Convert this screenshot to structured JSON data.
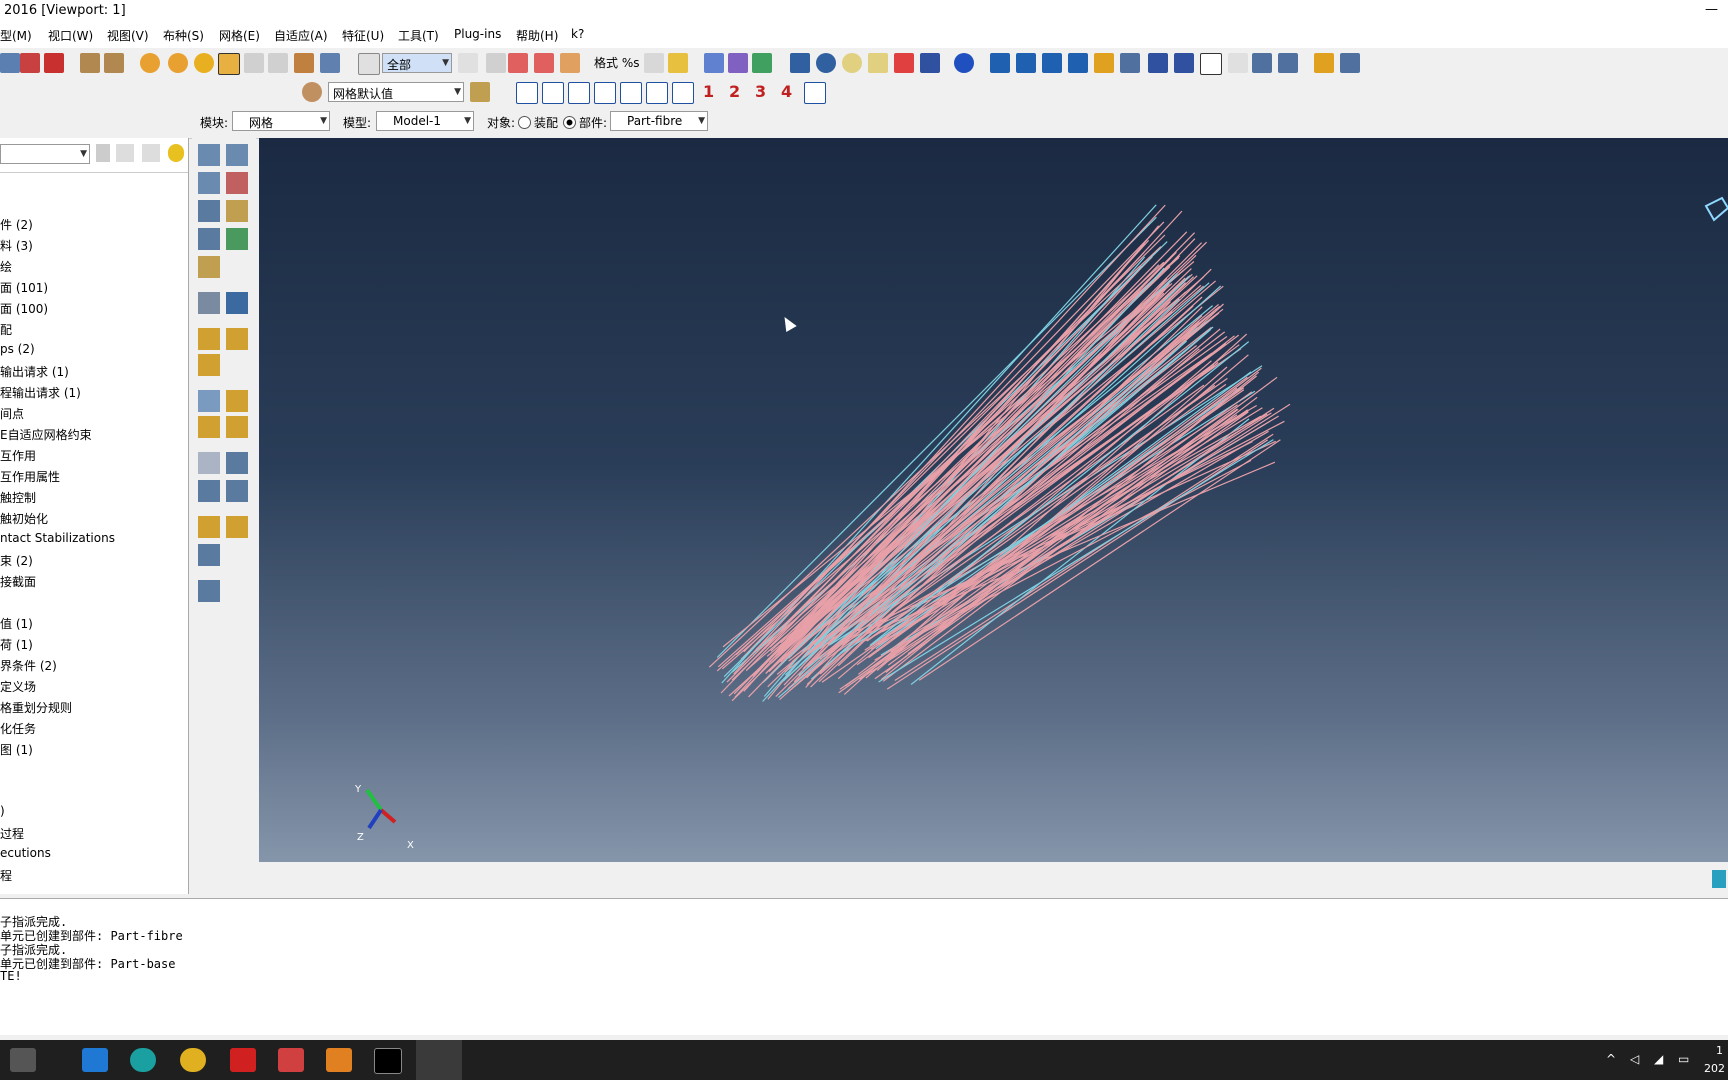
{
  "window": {
    "title": "2016 [Viewport: 1]",
    "minimize_glyph": "—"
  },
  "menu": [
    "型(M)",
    "视口(W)",
    "视图(V)",
    "布种(S)",
    "网格(E)",
    "自适应(A)",
    "特征(U)",
    "工具(T)",
    "Plug-ins",
    "帮助(H)",
    "k?"
  ],
  "toolbar": {
    "selection_filter": "全部",
    "render_style_label": "格式 %s",
    "mesh_defaults": "网格默认值",
    "view_numbers": [
      "1",
      "2",
      "3",
      "4"
    ]
  },
  "context": {
    "module_label": "模块:",
    "module_value": "网格",
    "model_label": "模型:",
    "model_value": "Model-1",
    "object_label": "对象:",
    "assembly_label": "装配",
    "part_label": "部件:",
    "part_value": "Part-fibre"
  },
  "tree": [
    "件 (2)",
    "料 (3)",
    "绘",
    "面 (101)",
    "面 (100)",
    "配",
    "ps (2)",
    "输出请求 (1)",
    "程输出请求 (1)",
    "间点",
    "E自适应网格约束",
    "互作用",
    "互作用属性",
    "触控制",
    "触初始化",
    "ntact Stabilizations",
    "束 (2)",
    "接截面",
    "",
    "值 (1)",
    "荷 (1)",
    "界条件 (2)",
    "定义场",
    "格重划分规则",
    "化任务",
    "图 (1)",
    "",
    "",
    ")",
    "过程",
    "ecutions",
    "程"
  ],
  "triad": {
    "x": "X",
    "y": "Y",
    "z": "Z"
  },
  "messages": [
    "子指派完成.",
    "单元已创建到部件: Part-fibre",
    "子指派完成.",
    "单元已创建到部件: Part-base",
    "TE!"
  ],
  "taskbar": {
    "clock_time": "1",
    "clock_date": "202"
  },
  "colors": {
    "viewport_top": "#1b2a42",
    "viewport_bottom": "#8595aa",
    "fibre": "#e8a0a8",
    "fibre_alt": "#7fd0e0"
  }
}
